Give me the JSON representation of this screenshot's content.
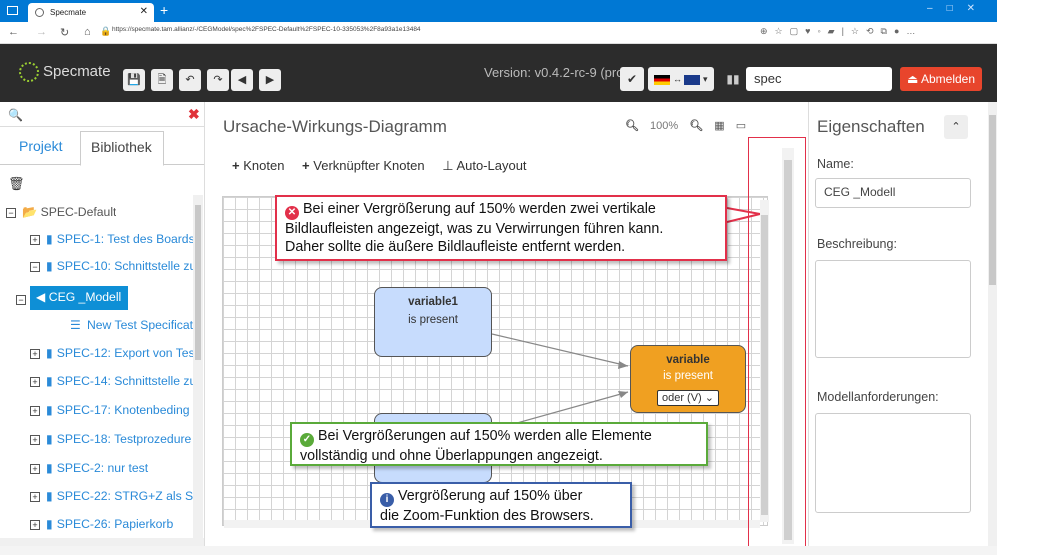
{
  "browser": {
    "tab_title": "Specmate",
    "url": "https://specmate.tam.allianz/-/CEGModel/spec%2FSPEC-Default%2FSPEC-10-335053%2F8a93a1e13484"
  },
  "navbar": {
    "brand": "Specmate",
    "version": "Version: v0.4.2-rc-9 (prod)",
    "user": "spec",
    "logout": "Abmelden"
  },
  "left": {
    "tabs": [
      "Projekt",
      "Bibliothek"
    ],
    "tree": [
      "SPEC-Default",
      "SPEC-1: Test des Boards",
      "SPEC-10: Schnittstelle zu",
      "CEG _Modell",
      "New Test Specificat",
      "SPEC-12: Export von Tes",
      "SPEC-14: Schnittstelle zu",
      "SPEC-17: Knotenbeding",
      "SPEC-18: Testprozedure",
      "SPEC-2: nur test",
      "SPEC-22: STRG+Z als Sh",
      "SPEC-26: Papierkorb"
    ]
  },
  "center": {
    "title": "Ursache-Wirkungs-Diagramm",
    "zoom": "100%",
    "toolbar": {
      "knoten": "Knoten",
      "verknuepfter": "Verknüpfter Knoten",
      "autolayout": "Auto-Layout"
    },
    "nodes": {
      "n1_name": "variable1",
      "n1_cond": "is present",
      "n3_name": "variable",
      "n3_cond": "is present",
      "n3_op": "oder (V)"
    }
  },
  "annotations": {
    "red_l1": "Bei einer Vergrößerung auf 150% werden zwei vertikale",
    "red_l2": "Bildlaufleisten angezeigt, was zu Verwirrungen führen kann.",
    "red_l3": "Daher sollte die äußere Bildlaufleiste entfernt werden.",
    "green_l1": "Bei Vergrößerungen auf 150% werden alle Elemente",
    "green_l2": "vollständig und ohne Überlappungen angezeigt.",
    "blue_l1": "Vergrößerung auf 150% über",
    "blue_l2": "die Zoom-Funktion des Browsers."
  },
  "right": {
    "title": "Eigenschaften",
    "name_label": "Name:",
    "name_value": "CEG _Modell",
    "desc_label": "Beschreibung:",
    "req_label": "Modellanforderungen:"
  },
  "colors": {
    "accent": "#0e8fd6",
    "danger": "#e2304a",
    "success": "#5aaa3a",
    "info": "#3a5ea8",
    "node_blue": "#c7dcfd",
    "node_orange": "#f0a021"
  }
}
